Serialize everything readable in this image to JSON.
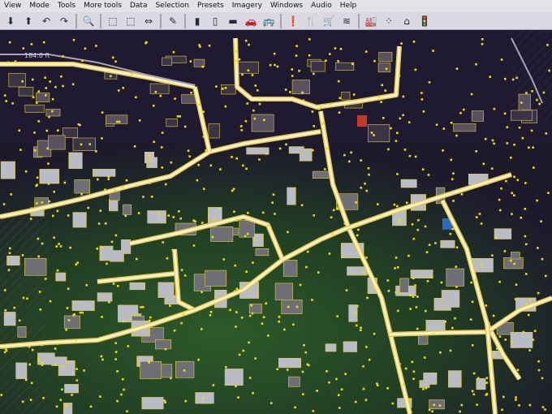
{
  "menu": [
    "View",
    "Mode",
    "Tools",
    "More tools",
    "Data",
    "Selection",
    "Presets",
    "Imagery",
    "Windows",
    "Audio",
    "Help"
  ],
  "toolbar": {
    "icons": [
      {
        "name": "download-icon",
        "glyph": "⬇"
      },
      {
        "name": "upload-icon",
        "glyph": "⬆"
      },
      {
        "name": "undo-icon",
        "glyph": "↶"
      },
      {
        "name": "redo-icon",
        "glyph": "↷"
      },
      {
        "name": "sep"
      },
      {
        "name": "zoom-icon",
        "glyph": "🔍"
      },
      {
        "name": "sep"
      },
      {
        "name": "select-icon",
        "glyph": "⬚"
      },
      {
        "name": "lasso-icon",
        "glyph": "⬚"
      },
      {
        "name": "move-icon",
        "glyph": "⇔"
      },
      {
        "name": "sep"
      },
      {
        "name": "draw-icon",
        "glyph": "✎"
      },
      {
        "name": "sep"
      },
      {
        "name": "road-icon",
        "glyph": "▮"
      },
      {
        "name": "path-icon",
        "glyph": "▯"
      },
      {
        "name": "building-icon",
        "glyph": "▬"
      },
      {
        "name": "car-icon",
        "glyph": "🚗"
      },
      {
        "name": "bus-icon",
        "glyph": "🚌"
      },
      {
        "name": "sep"
      },
      {
        "name": "warning-icon",
        "glyph": "❗"
      },
      {
        "name": "restaurant-icon",
        "glyph": "🍴"
      },
      {
        "name": "shop-icon",
        "glyph": "🛒"
      },
      {
        "name": "water-icon",
        "glyph": "≋"
      },
      {
        "name": "sep"
      },
      {
        "name": "industry-icon",
        "glyph": "🏭"
      },
      {
        "name": "node-grid-icon",
        "glyph": "⁘"
      },
      {
        "name": "home-icon",
        "glyph": "⌂"
      },
      {
        "name": "traffic-light-icon",
        "glyph": "🚦"
      }
    ]
  },
  "map": {
    "scale_label": "184.0 ft"
  }
}
